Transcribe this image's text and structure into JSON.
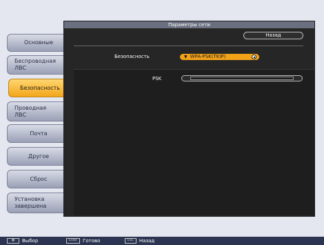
{
  "panel": {
    "title": "Параметры сети",
    "back_label": "Назад",
    "security_label": "Безопасность",
    "security_value": "WPA-PSK(TKIP)",
    "psk_label": "PSK"
  },
  "sidebar": {
    "items": [
      {
        "label": "Основные",
        "active": false
      },
      {
        "label": "Беспроводная\nЛВС",
        "active": false
      },
      {
        "label": "Безопасность",
        "active": true
      },
      {
        "label": "Проводная\nЛВС",
        "active": false
      },
      {
        "label": "Почта",
        "active": false
      },
      {
        "label": "Другое",
        "active": false
      },
      {
        "label": "Сброс",
        "active": false
      },
      {
        "label": "Установка\nзавершена",
        "active": false
      }
    ]
  },
  "help_bar": {
    "select_label": "Выбор",
    "enter_key": "Enter",
    "done_label": "Готово",
    "esc_key": "ESC",
    "back_label": "Назад"
  },
  "colors": {
    "accent": "#f2a219",
    "panel_bg": "#262626",
    "help_bar_bg": "#2b3450"
  },
  "icons": [
    "refresh-icon",
    "chevron-down-icon",
    "navigation-arrows-icon"
  ]
}
